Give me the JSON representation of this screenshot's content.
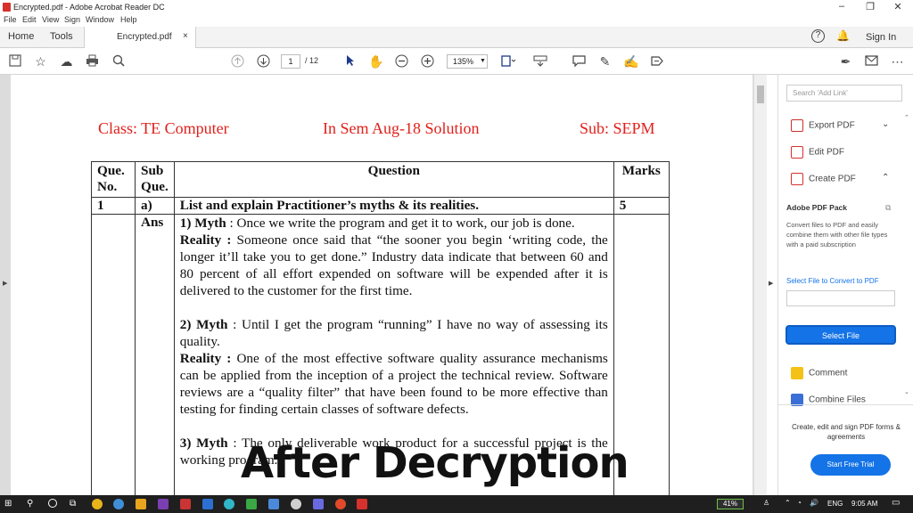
{
  "window": {
    "title": "Encrypted.pdf - Adobe Acrobat Reader DC",
    "minimize": "–",
    "restore": "❐",
    "close": "✕"
  },
  "menu": [
    "File",
    "Edit",
    "View",
    "Sign",
    "Window",
    "Help"
  ],
  "tabs": {
    "home": "Home",
    "tools": "Tools",
    "document": "Encrypted.pdf",
    "close": "×",
    "sign_in": "Sign In"
  },
  "toolbar": {
    "page_current": "1",
    "page_total": "/ 12",
    "zoom": "135%"
  },
  "document": {
    "header_left": "Class: TE Computer",
    "header_center": "In Sem Aug-18 Solution",
    "header_right": "Sub: SEPM",
    "col_que": "Que. No.",
    "col_sub": "Sub Que.",
    "col_question": "Question",
    "col_marks": "Marks",
    "row_no": "1",
    "row_sub": "a)",
    "row_question": "List and explain Practitioner’s myths & its realities.",
    "row_marks": "5",
    "ans_label": "Ans",
    "myth1_label": "1) Myth",
    "myth1_text": " : Once we write the program and get it to work, our job is done.",
    "reality1_label": "Reality :",
    "reality1_text": " Someone once said that “the sooner you begin ‘writing code, the longer it’ll take you to get done.” Industry data indicate that between 60 and 80 percent of all effort expended on software will be expended after it is delivered to the customer for the first time.",
    "myth2_label": "2) Myth",
    "myth2_text": " : Until I get the program “running” I have no way of assessing its quality.",
    "reality2_label": "Reality :",
    "reality2_text": " One of the most effective software quality assurance mechanisms can be applied from the inception of a project the technical review. Software reviews are a “quality filter” that have been found to be more effective than testing for finding certain classes of software defects.",
    "myth3_label": "3) Myth",
    "myth3_text": " : The only deliverable work product for a successful project is the working program.",
    "overlay": "After Decryption"
  },
  "sidebar": {
    "search_placeholder": "Search 'Add Link'",
    "export_pdf": "Export PDF",
    "edit_pdf": "Edit PDF",
    "create_pdf": "Create PDF",
    "pack_title": "Adobe PDF Pack",
    "pack_desc": "Convert files to PDF and easily combine them with other file types with a paid subscription",
    "select_file_link": "Select File to Convert to PDF",
    "select_file_button": "Select File",
    "comment": "Comment",
    "combine_files": "Combine Files",
    "promo": "Create, edit and sign PDF forms & agreements",
    "trial": "Start Free Trial"
  },
  "taskbar": {
    "battery": "41%",
    "lang": "ENG",
    "time": "9:05 AM"
  },
  "colors": {
    "accent": "#1473e6",
    "header_red": "#e0201b",
    "acrobat_red": "#d6322d"
  }
}
